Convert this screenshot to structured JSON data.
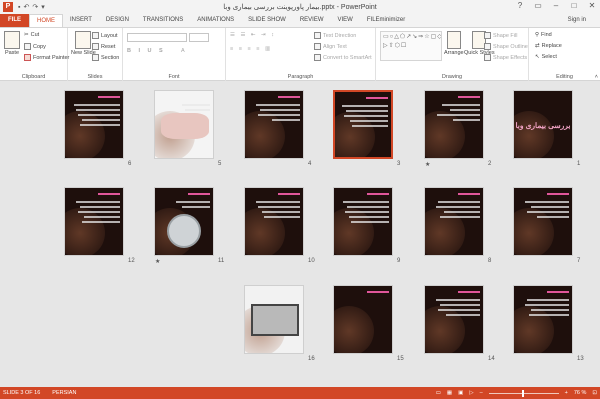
{
  "window": {
    "title": "بیمار پاورپوینت بررسی بیماری وبا.pptx - PowerPoint",
    "sign_in": "Sign in"
  },
  "tabs": [
    {
      "label": "FILE"
    },
    {
      "label": "HOME"
    },
    {
      "label": "INSERT"
    },
    {
      "label": "DESIGN"
    },
    {
      "label": "TRANSITIONS"
    },
    {
      "label": "ANIMATIONS"
    },
    {
      "label": "SLIDE SHOW"
    },
    {
      "label": "REVIEW"
    },
    {
      "label": "VIEW"
    },
    {
      "label": "FILEminimizer"
    }
  ],
  "ribbon": {
    "clipboard": {
      "label": "Clipboard",
      "paste": "Paste",
      "cut": "Cut",
      "copy": "Copy",
      "format_painter": "Format Painter"
    },
    "slides": {
      "label": "Slides",
      "new_slide": "New Slide",
      "layout": "Layout",
      "reset": "Reset",
      "section": "Section"
    },
    "font": {
      "label": "Font"
    },
    "paragraph": {
      "label": "Paragraph",
      "text_direction": "Text Direction",
      "align_text": "Align Text",
      "smartart": "Convert to SmartArt"
    },
    "drawing": {
      "label": "Drawing",
      "arrange": "Arrange",
      "quick_styles": "Quick Styles",
      "shape_fill": "Shape Fill",
      "shape_outline": "Shape Outline",
      "shape_effects": "Shape Effects"
    },
    "editing": {
      "label": "Editing",
      "find": "Find",
      "replace": "Replace",
      "select": "Select"
    }
  },
  "slides": [
    {
      "number": "1",
      "title": "بررسی بیماری وبا",
      "selected": false,
      "star": false
    },
    {
      "number": "2",
      "title": "",
      "selected": false,
      "star": true
    },
    {
      "number": "3",
      "title": "",
      "selected": true,
      "star": false
    },
    {
      "number": "4",
      "title": "",
      "selected": false,
      "star": false
    },
    {
      "number": "5",
      "title": "",
      "selected": false,
      "star": false
    },
    {
      "number": "6",
      "title": "",
      "selected": false,
      "star": false
    },
    {
      "number": "7",
      "title": "",
      "selected": false,
      "star": false
    },
    {
      "number": "8",
      "title": "",
      "selected": false,
      "star": false
    },
    {
      "number": "9",
      "title": "",
      "selected": false,
      "star": false
    },
    {
      "number": "10",
      "title": "",
      "selected": false,
      "star": false
    },
    {
      "number": "11",
      "title": "",
      "selected": false,
      "star": true
    },
    {
      "number": "12",
      "title": "",
      "selected": false,
      "star": false
    },
    {
      "number": "13",
      "title": "",
      "selected": false,
      "star": false
    },
    {
      "number": "14",
      "title": "",
      "selected": false,
      "star": false
    },
    {
      "number": "15",
      "title": "",
      "selected": false,
      "star": false
    },
    {
      "number": "16",
      "title": "",
      "selected": false,
      "star": false
    }
  ],
  "status": {
    "slide_info": "SLIDE 3 OF 16",
    "language": "PERSIAN",
    "zoom": "76 %"
  },
  "colors": {
    "accent": "#d24726",
    "slide_bg": "#1e0f0c",
    "slide_heading": "#e0569a"
  }
}
